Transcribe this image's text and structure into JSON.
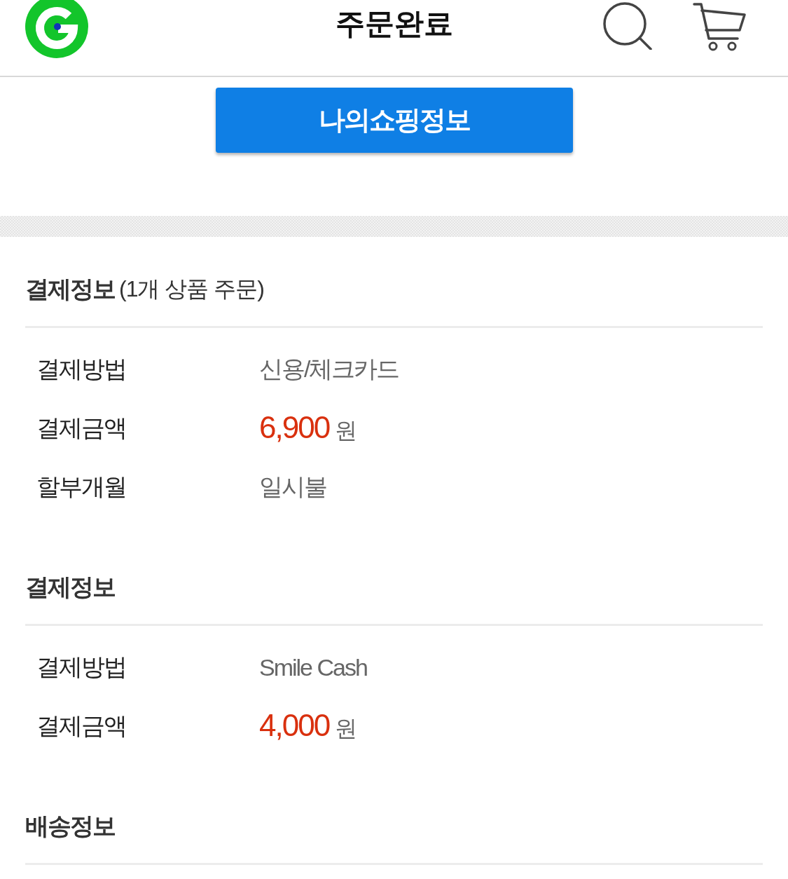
{
  "header": {
    "title": "주문완료"
  },
  "my_shopping_button": {
    "label": "나의쇼핑정보"
  },
  "sections": [
    {
      "title": "결제정보",
      "note": "(1개 상품 주문)",
      "rows": [
        {
          "kind": "text",
          "label": "결제방법",
          "value": "신용/체크카드"
        },
        {
          "kind": "amount",
          "label": "결제금액",
          "value": "6,900",
          "unit": "원"
        },
        {
          "kind": "text",
          "label": "할부개월",
          "value": "일시불"
        }
      ]
    },
    {
      "title": "결제정보",
      "rows": [
        {
          "kind": "text",
          "label": "결제방법",
          "value": "Smile Cash"
        },
        {
          "kind": "amount",
          "label": "결제금액",
          "value": "4,000",
          "unit": "원"
        }
      ]
    },
    {
      "title": "배송정보"
    }
  ]
}
